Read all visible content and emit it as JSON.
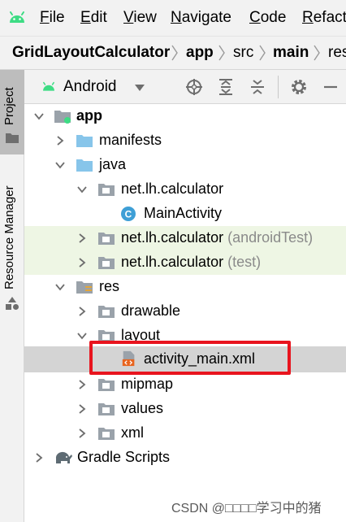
{
  "menubar": {
    "items": [
      {
        "label": "File",
        "mnemonic": "F",
        "rest": "ile"
      },
      {
        "label": "Edit",
        "mnemonic": "E",
        "rest": "dit"
      },
      {
        "label": "View",
        "mnemonic": "V",
        "rest": "iew"
      },
      {
        "label": "Navigate",
        "mnemonic": "N",
        "rest": "avigate"
      },
      {
        "label": "Code",
        "mnemonic": "C",
        "rest": "ode"
      },
      {
        "label": "Refact",
        "mnemonic": "R",
        "rest": "efact"
      }
    ]
  },
  "breadcrumb": [
    "GridLayoutCalculator",
    "app",
    "src",
    "main",
    "res"
  ],
  "sidebar": {
    "tabs": [
      "Project",
      "Resource Manager"
    ]
  },
  "toolbar": {
    "view_mode": "Android"
  },
  "tree": [
    {
      "label": "app",
      "suffix": "",
      "icon": "module-icon"
    },
    {
      "label": "manifests",
      "suffix": "",
      "icon": "folder-icon"
    },
    {
      "label": "java",
      "suffix": "",
      "icon": "folder-icon"
    },
    {
      "label": "net.lh.calculator",
      "suffix": "",
      "icon": "package-icon"
    },
    {
      "label": "MainActivity",
      "suffix": "",
      "icon": "class-icon"
    },
    {
      "label": "net.lh.calculator",
      "suffix": "(androidTest)",
      "icon": "package-icon"
    },
    {
      "label": "net.lh.calculator",
      "suffix": "(test)",
      "icon": "package-icon"
    },
    {
      "label": "res",
      "suffix": "",
      "icon": "res-folder-icon"
    },
    {
      "label": "drawable",
      "suffix": "",
      "icon": "package-icon"
    },
    {
      "label": "layout",
      "suffix": "",
      "icon": "package-icon"
    },
    {
      "label": "activity_main.xml",
      "suffix": "",
      "icon": "xml-file-icon"
    },
    {
      "label": "mipmap",
      "suffix": "",
      "icon": "package-icon"
    },
    {
      "label": "values",
      "suffix": "",
      "icon": "package-icon"
    },
    {
      "label": "xml",
      "suffix": "",
      "icon": "package-icon"
    },
    {
      "label": "Gradle Scripts",
      "suffix": "",
      "icon": "gradle-icon"
    }
  ],
  "watermark": "CSDN @□□□□学习中的猪",
  "colors": {
    "highlight": "#e8141e",
    "folder": "#87c5ea",
    "android_green": "#3ddc84",
    "class_icon": "#3e9fd6"
  }
}
